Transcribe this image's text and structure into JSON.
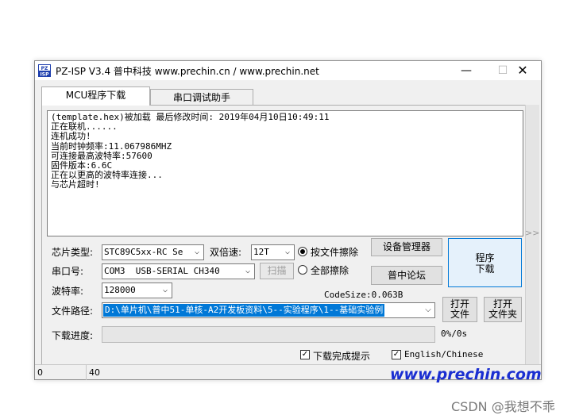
{
  "window": {
    "title": "PZ-ISP V3.4 普中科技  www.prechin.cn / www.prechin.net",
    "minimize_glyph": "—",
    "maximize_glyph": "☐",
    "close_glyph": "✕"
  },
  "tabs": [
    {
      "label": "MCU程序下载",
      "active": true
    },
    {
      "label": "串口调试助手",
      "active": false
    }
  ],
  "log": {
    "lines": "(template.hex)被加载 最后修改时间: 2019年04月10日10:49:11\n正在联机......\n连机成功!\n当前时钟频率:11.067986MHZ\n可连接最高波特率:57600\n固件版本:6.6C\n正在以更高的波特率连接...\n与芯片超时!"
  },
  "scroll_indicator": ">>",
  "form": {
    "chip_type_label": "芯片类型:",
    "chip_type_value": "STC89C5xx-RC Se",
    "double_speed_label": "双倍速:",
    "double_speed_value": "12T",
    "erase_by_file_label": "按文件擦除",
    "erase_all_label": "全部擦除",
    "device_manager_button": "设备管理器",
    "forum_button": "普中论坛",
    "program_download_button": "程序\n下载",
    "serial_label": "串口号:",
    "serial_value": "COM3  USB-SERIAL CH340",
    "scan_button": "扫描",
    "baud_label": "波特率:",
    "baud_value": "128000",
    "codesize_text": "CodeSize:0.063B",
    "file_path_label": "文件路径:",
    "file_path_value": "D:\\单片机\\普中51-单核-A2开发板资料\\5--实验程序\\1--基础实验例",
    "open_file_button": "打开\n文件",
    "open_folder_button": "打开\n文件夹",
    "progress_label": "下载进度:",
    "progress_percent_text": "0%/0s",
    "progress_value": 0,
    "download_done_tip_label": "下载完成提示",
    "english_chinese_label": "English/Chinese"
  },
  "status": {
    "left": "0",
    "right": "40",
    "brand": "www.prechin.com"
  },
  "watermark": "CSDN @我想不乖",
  "colors": {
    "selection": "#0078d7",
    "brand": "#1a2ed1",
    "app_icon_bg": "#1e3fae"
  },
  "app_icon_text": "PZ\nISP"
}
